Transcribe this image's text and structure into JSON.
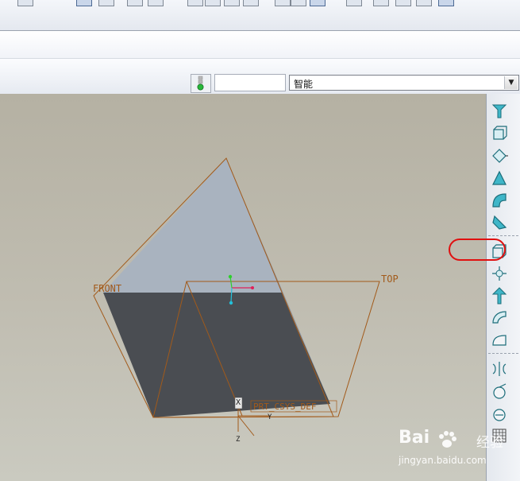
{
  "selection_filter": {
    "value": "智能"
  },
  "datum_labels": {
    "front": "FRONT",
    "top": "TOP",
    "csys": "PRT_CSYS_DEF",
    "csys_x": "X",
    "csys_y": "Y",
    "csys_z": "Z"
  },
  "watermark": {
    "brand": "Bai",
    "cn": "经验",
    "url": "jingyan.baidu.com"
  },
  "right_toolbar_icons": [
    "datum-plane-tool-icon",
    "extrude-icon",
    "revolve-icon",
    "blend-icon",
    "sweep-icon",
    "variable-section-icon",
    "shell-icon",
    "datum-axis-icon",
    "draft-icon",
    "round-icon",
    "rib-icon",
    "mirror-icon",
    "merge-icon",
    "trim-icon",
    "pattern-icon"
  ],
  "colors": {
    "datum": "#a25a1a",
    "annotation": "#e01010",
    "model_dark": "#4a4d52",
    "model_light": "#a9b3bf"
  }
}
